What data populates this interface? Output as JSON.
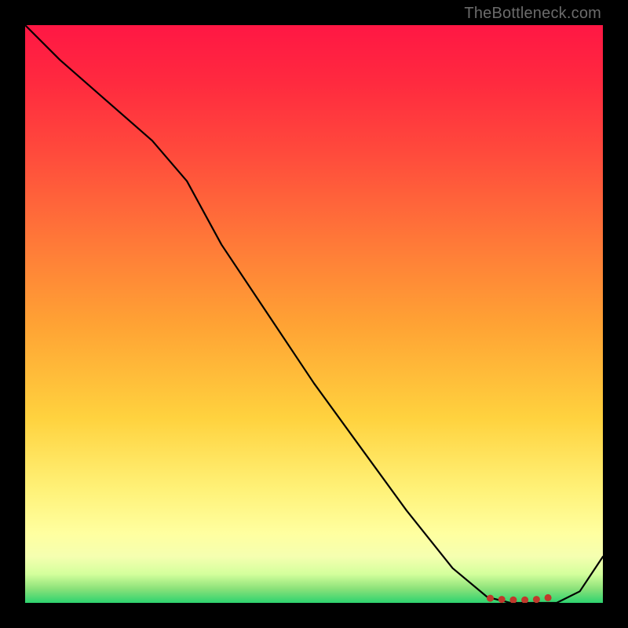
{
  "attribution": "TheBottleneck.com",
  "colors": {
    "frame": "#000000",
    "curve": "#000000",
    "marker": "#c0392b",
    "gradient_stops": [
      "#ff1744",
      "#ff2a3f",
      "#ff4a3c",
      "#ff7a38",
      "#ffa334",
      "#ffd23e",
      "#fff176",
      "#ffffa0",
      "#f5ffb0",
      "#d4ff9c",
      "#8de27a",
      "#2dd36f"
    ]
  },
  "chart_data": {
    "type": "line",
    "title": "",
    "xlabel": "",
    "ylabel": "",
    "xlim": [
      0,
      100
    ],
    "ylim": [
      0,
      100
    ],
    "grid": false,
    "legend": false,
    "note": "Axes unlabeled; values are normalized 0–100 estimated from pixel position. y=0 is the bottom (green) edge.",
    "series": [
      {
        "name": "curve",
        "x": [
          0,
          6,
          14,
          22,
          28,
          34,
          42,
          50,
          58,
          66,
          74,
          80,
          84,
          88,
          92,
          96,
          100
        ],
        "y": [
          100,
          94,
          87,
          80,
          73,
          62,
          50,
          38,
          27,
          16,
          6,
          1,
          0,
          0,
          0,
          2,
          8
        ]
      }
    ],
    "markers": {
      "name": "bottom-cluster",
      "x": [
        80.5,
        82.5,
        84.5,
        86.5,
        88.5,
        90.5
      ],
      "y": [
        0.8,
        0.6,
        0.5,
        0.5,
        0.6,
        0.9
      ]
    }
  }
}
